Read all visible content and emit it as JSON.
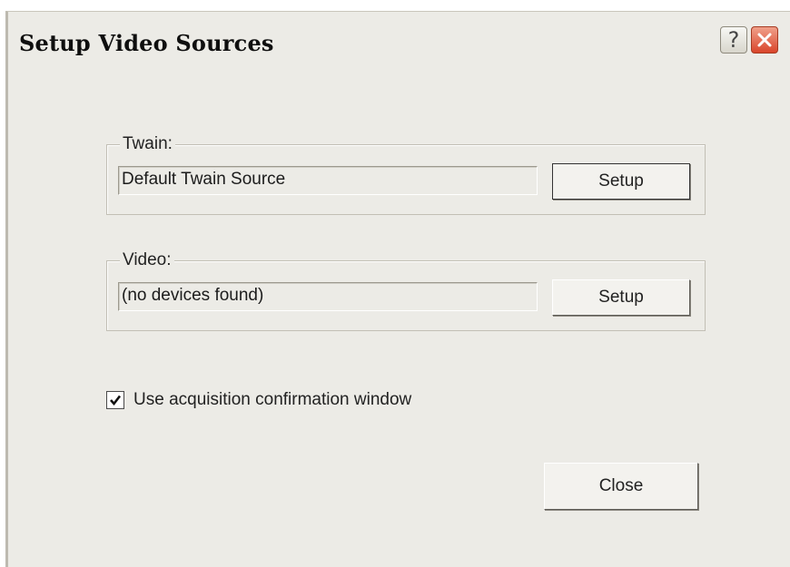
{
  "window": {
    "title": "Setup Video Sources",
    "help_glyph": "?",
    "help_icon": "question-mark-icon",
    "close_icon": "close-x-icon",
    "close_color": "#d9452b"
  },
  "twain": {
    "group_label": "Twain:",
    "source_value": "Default Twain Source",
    "setup_label": "Setup"
  },
  "video": {
    "group_label": "Video:",
    "source_value": "(no devices found)",
    "setup_label": "Setup"
  },
  "options": {
    "confirmation_label": "Use acquisition confirmation window",
    "confirmation_checked": true
  },
  "footer": {
    "close_label": "Close"
  }
}
